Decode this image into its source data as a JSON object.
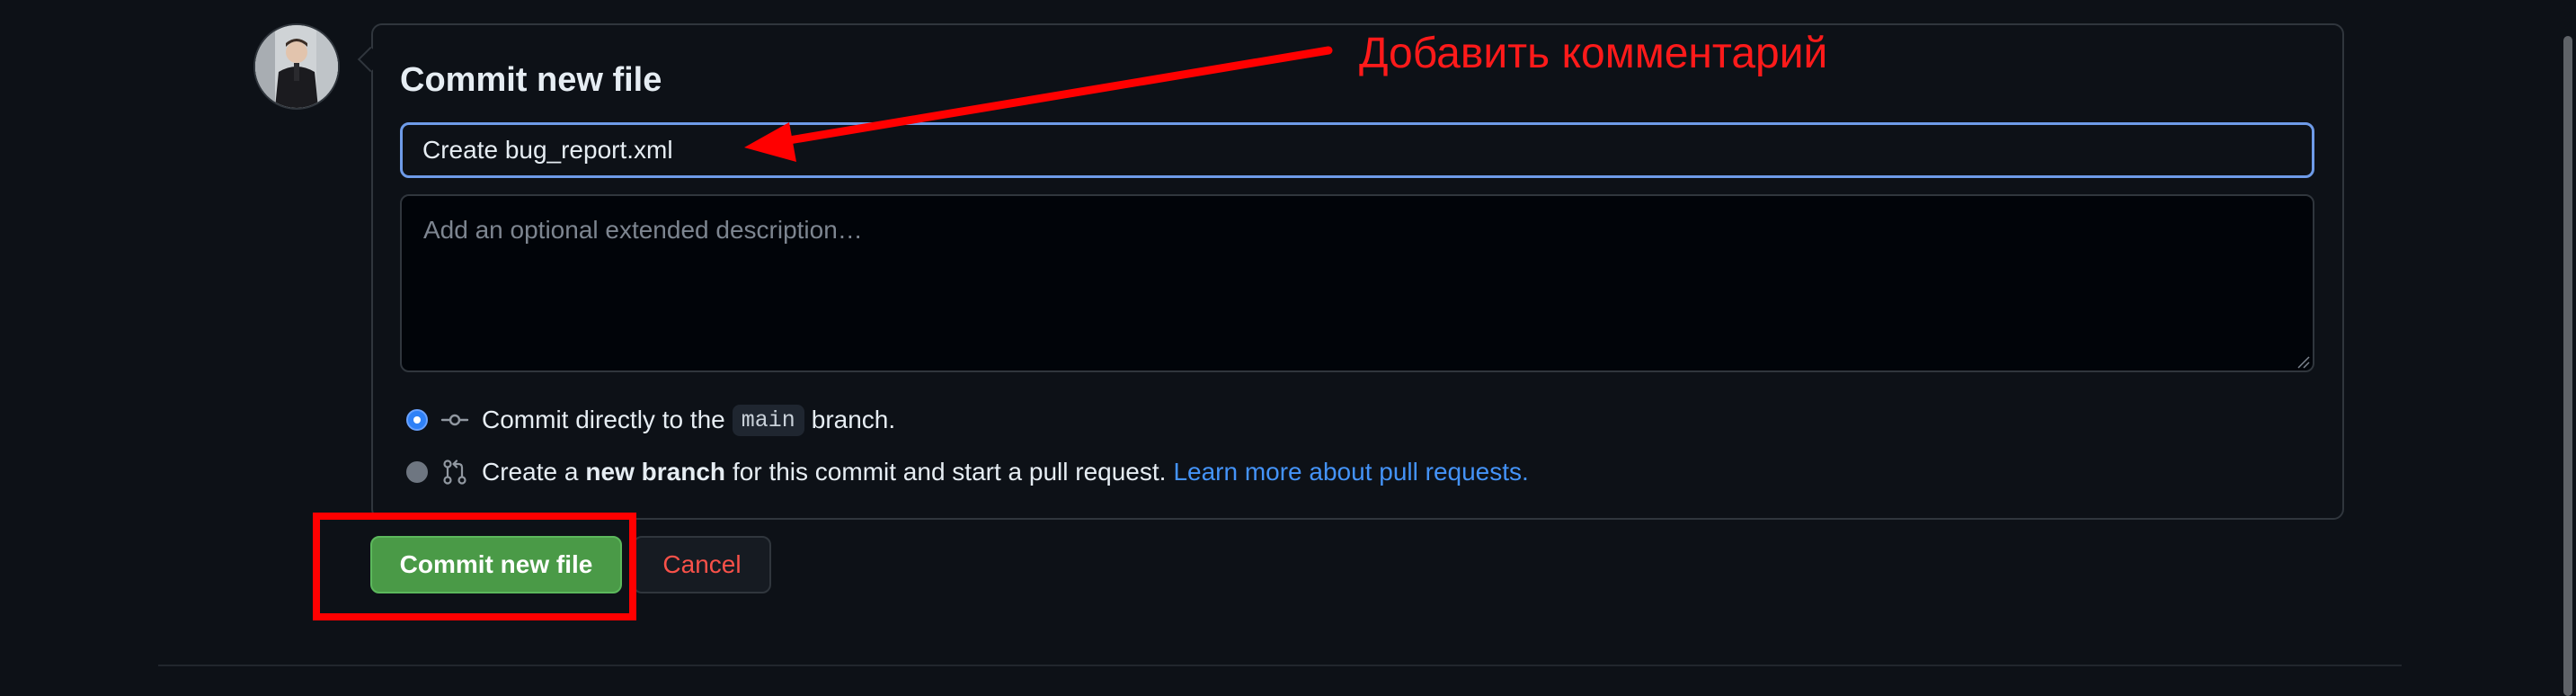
{
  "commit": {
    "title": "Commit new file",
    "summary_value": "Create bug_report.xml",
    "description_placeholder": "Add an optional extended description…"
  },
  "options": {
    "direct": {
      "prefix": "Commit directly to the",
      "branch": "main",
      "suffix": "branch.",
      "selected": true,
      "icon": "git-commit-icon"
    },
    "new_branch": {
      "prefix": "Create a",
      "bold": "new branch",
      "suffix": "for this commit and start a pull request.",
      "link": "Learn more about pull requests.",
      "selected": false,
      "icon": "git-pull-request-icon"
    }
  },
  "buttons": {
    "commit_label": "Commit new file",
    "cancel_label": "Cancel"
  },
  "annotation": {
    "text": "Добавить комментарий",
    "color": "#ff0000"
  },
  "colors": {
    "background": "#0d1117",
    "primary_button": "#4a9a47",
    "link": "#4493f8",
    "focus_border": "#6e9be8",
    "danger_text": "#f85149"
  }
}
